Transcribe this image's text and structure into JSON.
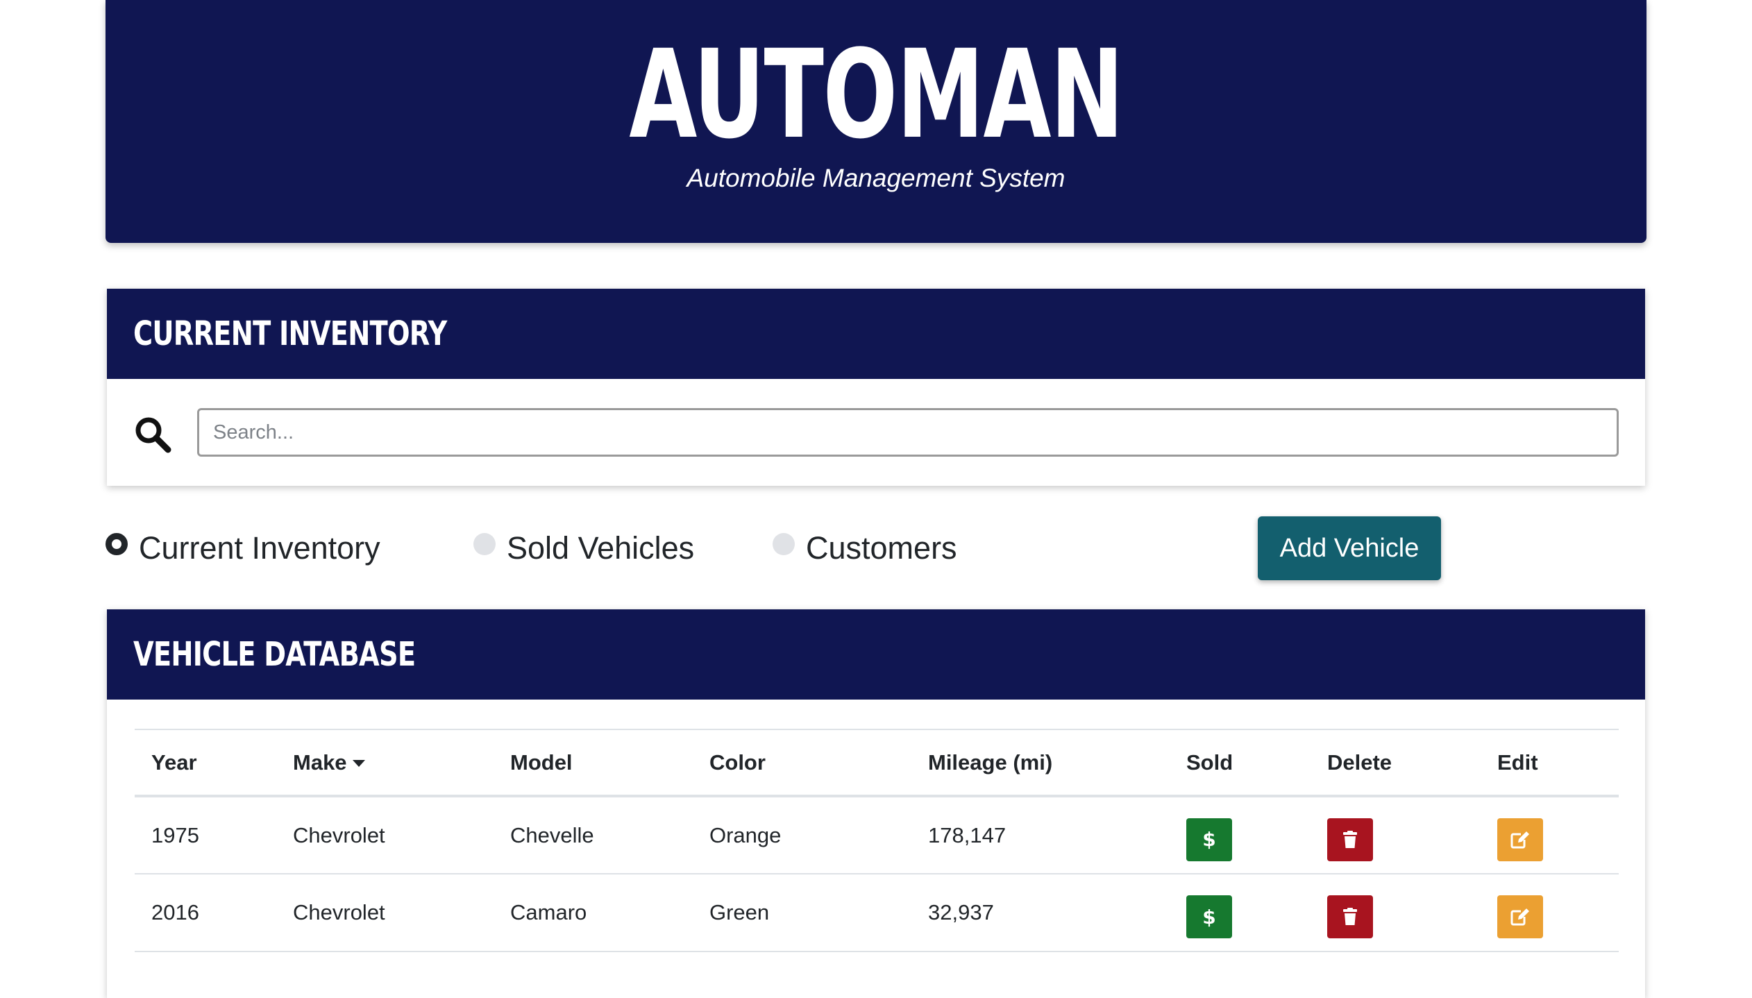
{
  "header": {
    "title": "AUTOMAN",
    "subtitle": "Automobile Management System"
  },
  "search_card": {
    "title": "CURRENT INVENTORY",
    "search_placeholder": "Search..."
  },
  "view_options": [
    {
      "label": "Current Inventory",
      "selected": true
    },
    {
      "label": "Sold Vehicles",
      "selected": false
    },
    {
      "label": "Customers",
      "selected": false
    }
  ],
  "add_button_label": "Add Vehicle",
  "table_card": {
    "title": "VEHICLE DATABASE",
    "columns": [
      "Year",
      "Make",
      "Model",
      "Color",
      "Mileage (mi)",
      "Sold",
      "Delete",
      "Edit"
    ],
    "sorted_column": "Make",
    "rows": [
      {
        "year": "1975",
        "make": "Chevrolet",
        "model": "Chevelle",
        "color": "Orange",
        "mileage": "178,147"
      },
      {
        "year": "2016",
        "make": "Chevrolet",
        "model": "Camaro",
        "color": "Green",
        "mileage": "32,937"
      }
    ]
  },
  "colors": {
    "navy": "#101652",
    "teal": "#135f6e",
    "sold_green": "#16792f",
    "delete_red": "#a8141f",
    "edit_orange": "#eba032"
  },
  "icons": {
    "sold": "dollar-icon",
    "delete": "trash-icon",
    "edit": "edit-icon"
  }
}
